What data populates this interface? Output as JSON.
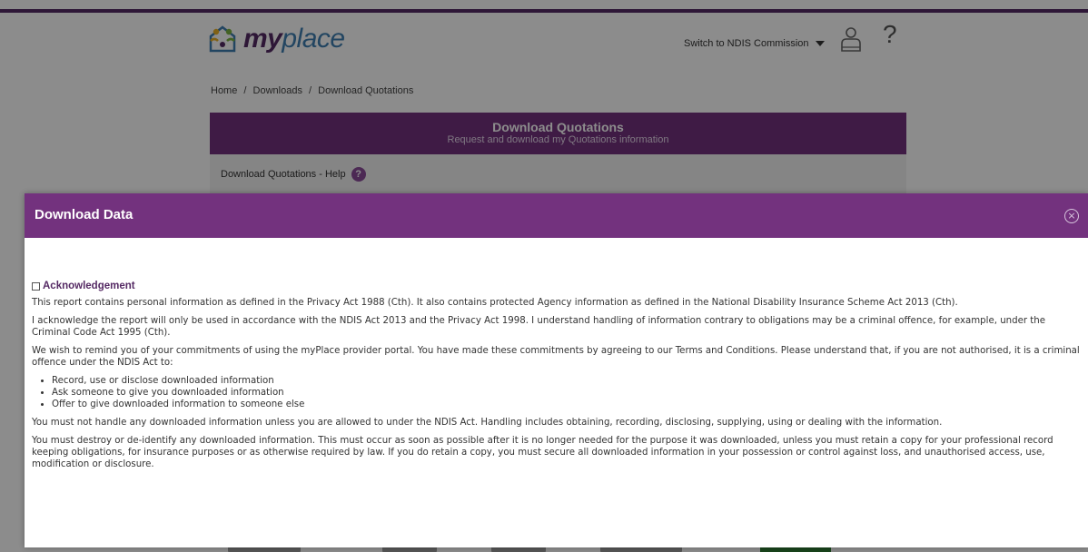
{
  "header": {
    "logo_prefix": "my",
    "logo_suffix": "place",
    "switch_label": "Switch to NDIS Commission",
    "help_glyph": "?",
    "user_icon": "user-icon"
  },
  "breadcrumb": [
    "Home",
    "/",
    "Downloads",
    "/",
    "Download Quotations"
  ],
  "banner": {
    "title": "Download Quotations",
    "subtitle": "Request and download my Quotations information"
  },
  "help": {
    "label": "Download Quotations - Help",
    "glyph": "?"
  },
  "modal": {
    "title": "Download Data",
    "close_glyph": "×",
    "ack_label": "Acknowledgement",
    "ack_checked": false,
    "paragraphs": [
      "This report contains personal information as defined in the Privacy Act 1988 (Cth). It also contains protected Agency information as defined in the National Disability Insurance Scheme Act 2013 (Cth).",
      "I acknowledge the report will only be used in accordance with the NDIS Act 2013 and the Privacy Act 1998. I understand handling of information contrary to obligations may be a criminal offence, for example, under the Criminal Code Act 1995 (Cth).",
      "We wish to remind you of your commitments of using the myPlace provider portal. You have made these commitments by agreeing to our Terms and Conditions. Please understand that, if you are not authorised, it is a criminal offence under the NDIS Act to:"
    ],
    "bullets": [
      "Record, use or disclose downloaded information",
      "Ask someone to give you downloaded information",
      "Offer to give downloaded information to someone else"
    ],
    "after": [
      "You must not handle any downloaded information unless you are allowed to under the NDIS Act. Handling includes obtaining, recording, disclosing, supplying, using or dealing with the information.",
      "You must destroy or de-identify any downloaded information. This must occur as soon as possible after it is no longer needed for the purpose it was downloaded, unless you must retain a copy for your professional record keeping obligations, for insurance purposes or as otherwise required by law. If you do retain a copy, you must secure all downloaded information in your possession or control against loss, and unauthorised access, use, modification or disclosure."
    ]
  },
  "colors": {
    "brand_purple": "#73327e",
    "dark_purple": "#552a64",
    "logo_blue": "#3f7fb1"
  }
}
